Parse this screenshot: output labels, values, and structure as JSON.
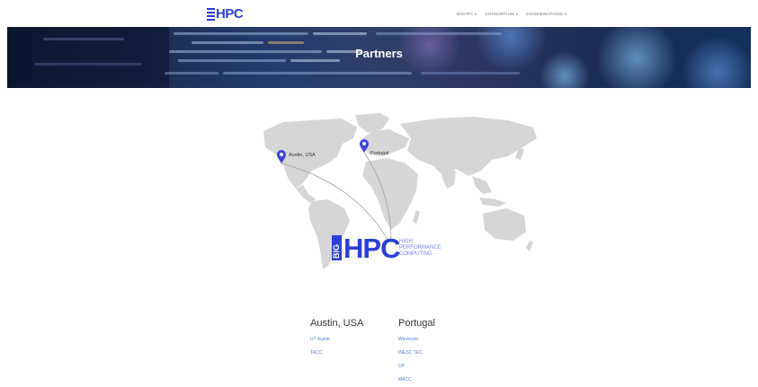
{
  "header": {
    "logo_text": "HPC",
    "nav": [
      {
        "label": "BIGHPC"
      },
      {
        "label": "CONSORTIUM"
      },
      {
        "label": "DISSEMINATIONS"
      }
    ]
  },
  "hero": {
    "title": "Partners"
  },
  "map": {
    "pins": [
      {
        "label": "Austin, USA"
      },
      {
        "label": "Portugal"
      }
    ],
    "brand": {
      "mark": "BIG",
      "text": "HPC",
      "tagline": [
        "HIGH",
        "PERFORMANCE",
        "COMPUTING"
      ]
    }
  },
  "partners": [
    {
      "region": "Austin, USA",
      "links": [
        "UT Austin",
        "TACC"
      ]
    },
    {
      "region": "Portugal",
      "links": [
        "Wavecom",
        "INESC TEC",
        "UP",
        "MACC"
      ]
    }
  ],
  "colors": {
    "brand_blue": "#2b3fd6",
    "link_blue": "#5a7fd4",
    "map_gray": "#d6d6d6"
  }
}
